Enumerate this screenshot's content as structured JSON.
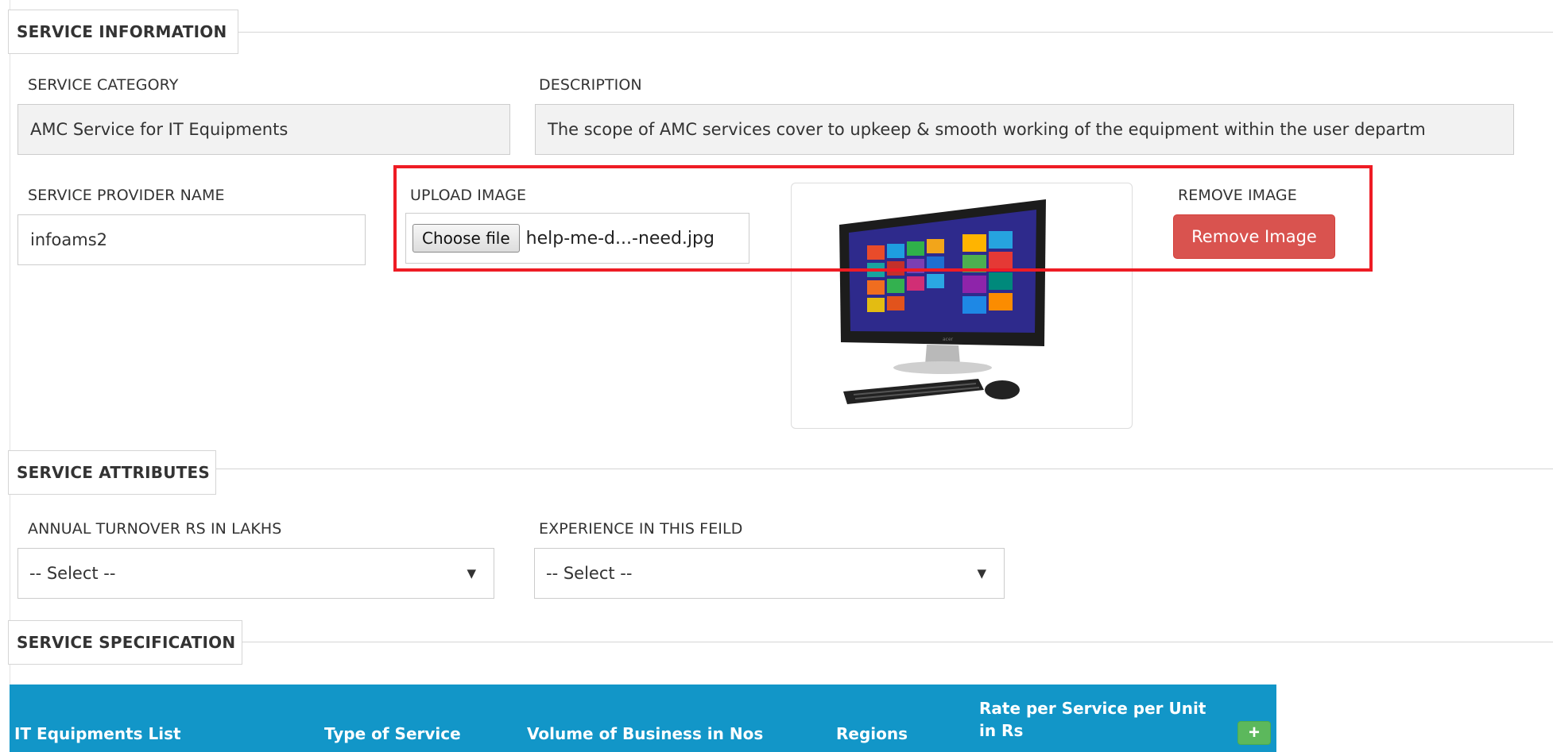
{
  "service_information": {
    "legend": "SERVICE INFORMATION",
    "category_label": "SERVICE CATEGORY",
    "category_value": "AMC Service for IT Equipments",
    "description_label": "DESCRIPTION",
    "description_value": "The scope of AMC services cover to upkeep & smooth working of the equipment within the user departm",
    "provider_label": "SERVICE PROVIDER NAME",
    "provider_value": "infoams2",
    "upload_label": "UPLOAD IMAGE",
    "choose_file_label": "Choose file",
    "file_name": "help-me-d...-need.jpg",
    "remove_label": "REMOVE IMAGE",
    "remove_button": "Remove Image",
    "preview_logo": "acer"
  },
  "service_attributes": {
    "legend": "SERVICE ATTRIBUTES",
    "turnover_label": "ANNUAL TURNOVER RS IN LAKHS",
    "turnover_value": "-- Select --",
    "experience_label": "EXPERIENCE IN THIS FEILD",
    "experience_value": "-- Select --"
  },
  "service_specification": {
    "legend": "SERVICE SPECIFICATION",
    "columns": [
      "IT Equipments List",
      "Type of Service",
      "Volume of Business in Nos",
      "Regions",
      "Rate per Service per Unit in Rs"
    ],
    "add_label": "+"
  },
  "colors": {
    "table_header": "#1296c8",
    "remove_button": "#d9534f",
    "add_button": "#5cb85c",
    "highlight": "#ee1c24"
  },
  "icons": {
    "caret": "caret-down-icon",
    "add": "plus-icon"
  }
}
